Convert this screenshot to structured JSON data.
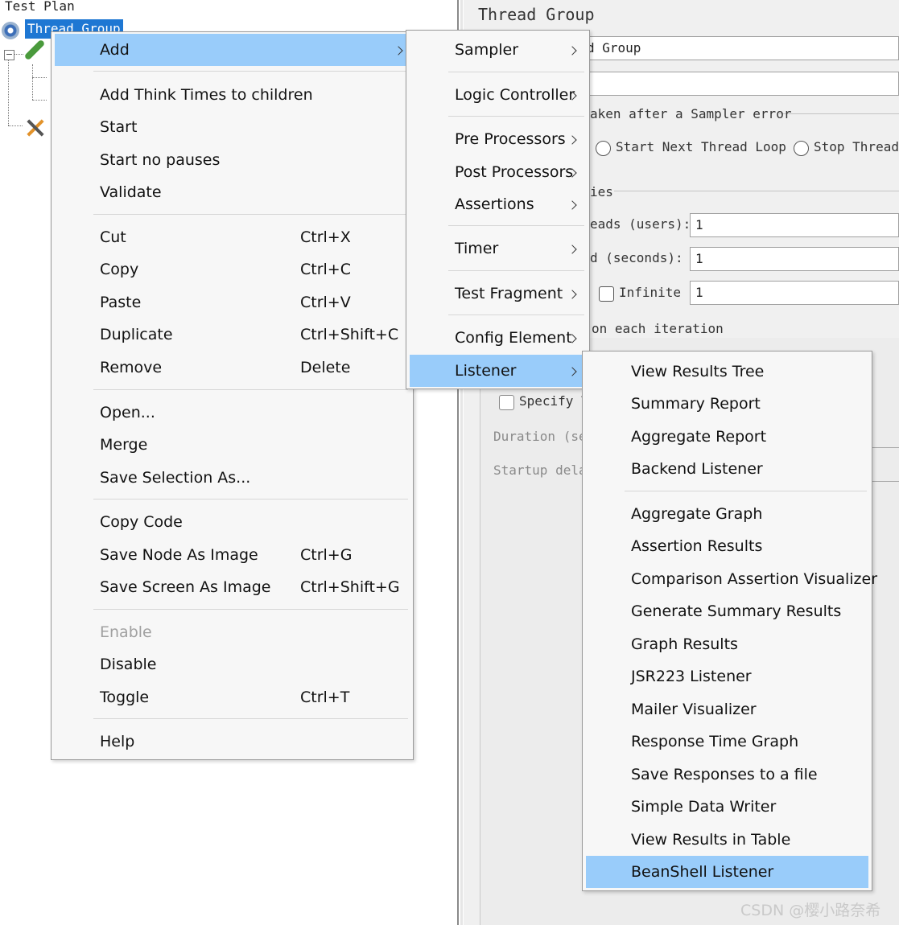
{
  "tree": {
    "root_label": "Test Plan",
    "selected_label": "Thread Group"
  },
  "panel": {
    "title": "Thread Group",
    "name_value": "d Group",
    "comments_value": "",
    "error_group_label": "aken after a Sampler error",
    "radio_next_loop": "Start Next Thread Loop",
    "radio_stop_thread": "Stop Thread",
    "properties_label": "ies",
    "threads_label": "eads (users):",
    "threads_value": "1",
    "rampup_label": "d (seconds):",
    "rampup_value": "1",
    "infinite_label": "Infinite",
    "loop_value": "1",
    "same_user_label": "on each iteration",
    "specify_label": "Specify T",
    "duration_label": "Duration (se",
    "startup_label": "Startup dela"
  },
  "context_menu": {
    "items": [
      {
        "label": "Add",
        "shortcut": "",
        "has_submenu": true,
        "selected": true
      },
      {
        "label": "Add Think Times to children",
        "shortcut": ""
      },
      {
        "label": "Start",
        "shortcut": ""
      },
      {
        "label": "Start no pauses",
        "shortcut": ""
      },
      {
        "label": "Validate",
        "shortcut": ""
      },
      {
        "label": "Cut",
        "shortcut": "Ctrl+X"
      },
      {
        "label": "Copy",
        "shortcut": "Ctrl+C"
      },
      {
        "label": "Paste",
        "shortcut": "Ctrl+V"
      },
      {
        "label": "Duplicate",
        "shortcut": "Ctrl+Shift+C"
      },
      {
        "label": "Remove",
        "shortcut": "Delete"
      },
      {
        "label": "Open...",
        "shortcut": ""
      },
      {
        "label": "Merge",
        "shortcut": ""
      },
      {
        "label": "Save Selection As...",
        "shortcut": ""
      },
      {
        "label": "Copy Code",
        "shortcut": ""
      },
      {
        "label": "Save Node As Image",
        "shortcut": "Ctrl+G"
      },
      {
        "label": "Save Screen As Image",
        "shortcut": "Ctrl+Shift+G"
      },
      {
        "label": "Enable",
        "shortcut": "",
        "disabled": true
      },
      {
        "label": "Disable",
        "shortcut": ""
      },
      {
        "label": "Toggle",
        "shortcut": "Ctrl+T"
      },
      {
        "label": "Help",
        "shortcut": ""
      }
    ]
  },
  "add_menu": {
    "items": [
      {
        "label": "Sampler"
      },
      {
        "label": "Logic Controller"
      },
      {
        "label": "Pre Processors"
      },
      {
        "label": "Post Processors"
      },
      {
        "label": "Assertions"
      },
      {
        "label": "Timer"
      },
      {
        "label": "Test Fragment"
      },
      {
        "label": "Config Element"
      },
      {
        "label": "Listener",
        "selected": true
      }
    ]
  },
  "listener_menu": {
    "items": [
      {
        "label": "View Results Tree"
      },
      {
        "label": "Summary Report"
      },
      {
        "label": "Aggregate Report"
      },
      {
        "label": "Backend Listener"
      },
      {
        "label": "Aggregate Graph"
      },
      {
        "label": "Assertion Results"
      },
      {
        "label": "Comparison Assertion Visualizer"
      },
      {
        "label": "Generate Summary Results"
      },
      {
        "label": "Graph Results"
      },
      {
        "label": "JSR223 Listener"
      },
      {
        "label": "Mailer Visualizer"
      },
      {
        "label": "Response Time Graph"
      },
      {
        "label": "Save Responses to a file"
      },
      {
        "label": "Simple Data Writer"
      },
      {
        "label": "View Results in Table"
      },
      {
        "label": "BeanShell Listener",
        "selected": true
      }
    ]
  },
  "watermark": "CSDN @樱小路奈希",
  "colors": {
    "selection": "#99ccfa",
    "tree_selection": "#1e77d3",
    "menu_background": "#f7f7f7"
  }
}
